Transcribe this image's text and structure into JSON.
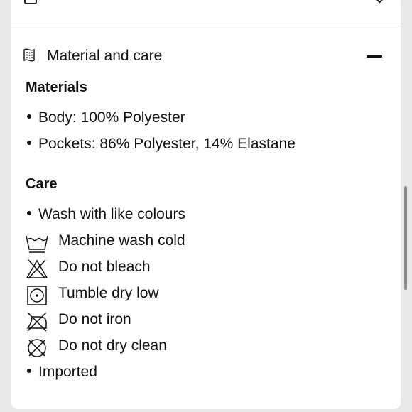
{
  "section": {
    "title": "Material and care",
    "header_icon": "fabric-swatch-icon",
    "collapse_icon": "minus-icon"
  },
  "materials": {
    "heading": "Materials",
    "items": [
      "Body: 100% Polyester",
      "Pockets: 86% Polyester, 14% Elastane"
    ]
  },
  "care": {
    "heading": "Care",
    "bullet_first": "Wash with like colours",
    "instructions": [
      {
        "icon": "machine-wash-cold-icon",
        "label": "Machine wash cold"
      },
      {
        "icon": "do-not-bleach-icon",
        "label": "Do not bleach"
      },
      {
        "icon": "tumble-dry-low-icon",
        "label": "Tumble dry low"
      },
      {
        "icon": "do-not-iron-icon",
        "label": "Do not iron"
      },
      {
        "icon": "do-not-dry-clean-icon",
        "label": "Do not dry clean"
      }
    ],
    "bullet_last": "Imported"
  },
  "colors": {
    "background": "#e9e9ea",
    "card": "#ffffff",
    "text": "#111111",
    "scrollbar": "#8d8d8d"
  }
}
